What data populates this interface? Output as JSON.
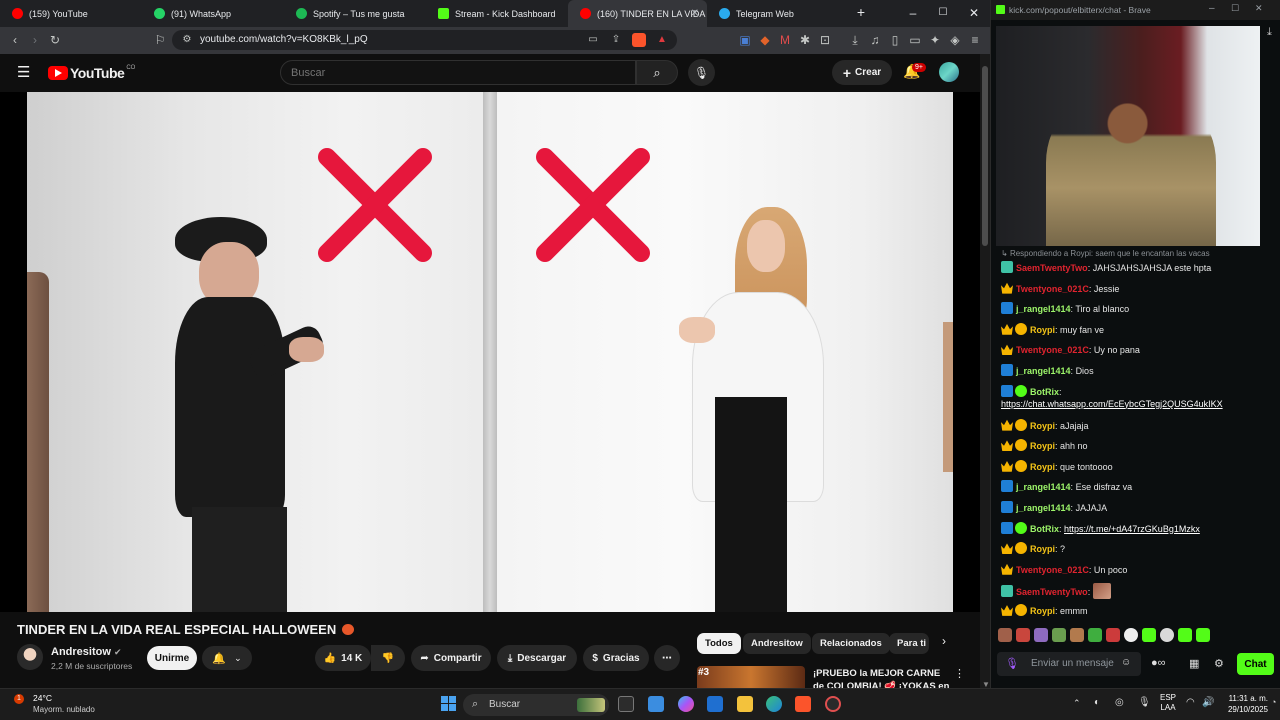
{
  "browser": {
    "tabs": [
      {
        "label": "(159) YouTube",
        "color": "#ff0000"
      },
      {
        "label": "(91) WhatsApp",
        "color": "#25d366"
      },
      {
        "label": "Spotify – Tus me gusta",
        "color": "#1db954"
      },
      {
        "label": "Stream - Kick Dashboard",
        "color": "#53fc18"
      },
      {
        "label": "(160) TINDER EN LA VIDA",
        "color": "#ff0000"
      },
      {
        "label": "Telegram Web",
        "color": "#2aabee"
      }
    ],
    "url": "youtube.com/watch?v=KO8KBk_l_pQ"
  },
  "youtube": {
    "logo_text": "YouTube",
    "region": "CO",
    "search_placeholder": "Buscar",
    "create_label": "Crear",
    "notification_count": "9+",
    "video_title": "TINDER EN LA VIDA REAL ESPECIAL HALLOWEEN",
    "channel_name": "Andresitow",
    "subscribers": "2,2 M de suscriptores",
    "subscribe_label": "Unirme",
    "likes": "14 K",
    "share_label": "Compartir",
    "download_label": "Descargar",
    "thanks_label": "Gracias",
    "chips": [
      "Todos",
      "Andresitow",
      "Relacionados",
      "Para ti"
    ],
    "recommended": {
      "rank": "#3",
      "title": "¡PRUEBO la MEJOR CARNE de COLOMBIA! 🥩 ¡YOKAS en"
    }
  },
  "kick": {
    "url": "kick.com/popout/elbitterx/chat - Brave",
    "reply_note": "Respondiendo a Roypi: saem que le encantan las vacas",
    "messages": [
      {
        "badges": [
          "sub"
        ],
        "user": "SaemTwentyTwo",
        "color": "red",
        "text": "JAHSJAHSJAHSJA este hpta"
      },
      {
        "badges": [
          "crown"
        ],
        "user": "Twentyone_021C",
        "color": "red",
        "text": "Jessie"
      },
      {
        "badges": [
          "x"
        ],
        "user": "j_rangel1414",
        "color": "green",
        "text": "Tiro al blanco"
      },
      {
        "badges": [
          "crown",
          "one"
        ],
        "user": "Roypi",
        "color": "yellow",
        "text": "muy fan ve"
      },
      {
        "badges": [
          "crown"
        ],
        "user": "Twentyone_021C",
        "color": "red",
        "text": "Uy no pana"
      },
      {
        "badges": [
          "x"
        ],
        "user": "j_rangel1414",
        "color": "green",
        "text": "Dios"
      },
      {
        "badges": [
          "x",
          "bot"
        ],
        "user": "BotRix",
        "color": "green",
        "text": "",
        "link": "https://chat.whatsapp.com/EcEybcGTegj2QUSG4ukIKX",
        "wrap": true
      },
      {
        "badges": [
          "crown",
          "one"
        ],
        "user": "Roypi",
        "color": "yellow",
        "text": "aJajaja"
      },
      {
        "badges": [
          "crown",
          "one"
        ],
        "user": "Roypi",
        "color": "yellow",
        "text": "ahh no"
      },
      {
        "badges": [
          "crown",
          "one"
        ],
        "user": "Roypi",
        "color": "yellow",
        "text": "que tontoooo"
      },
      {
        "badges": [
          "x"
        ],
        "user": "j_rangel1414",
        "color": "green",
        "text": "Ese disfraz va"
      },
      {
        "badges": [
          "x"
        ],
        "user": "j_rangel1414",
        "color": "green",
        "text": "JAJAJA"
      },
      {
        "badges": [
          "x",
          "bot"
        ],
        "user": "BotRix",
        "color": "green",
        "text": "",
        "link": "https://t.me/+dA47rzGKuBg1Mzkx"
      },
      {
        "badges": [
          "crown",
          "one"
        ],
        "user": "Roypi",
        "color": "yellow",
        "text": "?"
      },
      {
        "badges": [
          "crown"
        ],
        "user": "Twentyone_021C",
        "color": "red",
        "text": "Un poco"
      },
      {
        "badges": [
          "sub"
        ],
        "user": "SaemTwentyTwo",
        "color": "red",
        "text": "",
        "emote": true
      },
      {
        "badges": [
          "crown",
          "one"
        ],
        "user": "Roypi",
        "color": "yellow",
        "text": "emmm"
      }
    ],
    "input_placeholder": "Enviar un mensaje",
    "chat_button": "Chat"
  },
  "taskbar": {
    "temperature": "24°C",
    "weather": "Mayorm. nublado",
    "search_placeholder": "Buscar",
    "lang1": "ESP",
    "lang2": "LAA",
    "time": "11:31 a. m.",
    "date": "29/10/2025"
  }
}
